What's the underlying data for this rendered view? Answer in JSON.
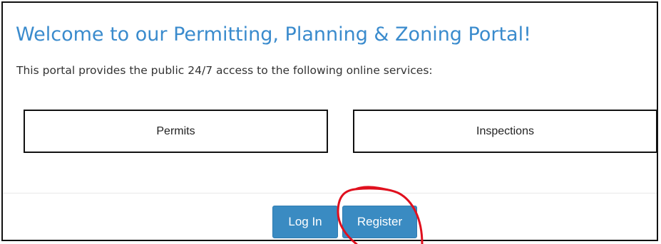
{
  "portal": {
    "title": "Welcome to our Permitting, Planning & Zoning Portal!",
    "subtitle": "This portal provides the public 24/7 access to the following online services:"
  },
  "services": [
    {
      "label": "Permits"
    },
    {
      "label": "Inspections"
    }
  ],
  "actions": {
    "login_label": "Log In",
    "register_label": "Register"
  },
  "colors": {
    "title_blue": "#3a8bcd",
    "button_blue": "#3a8bc2",
    "annotation_red": "#e0101e"
  }
}
